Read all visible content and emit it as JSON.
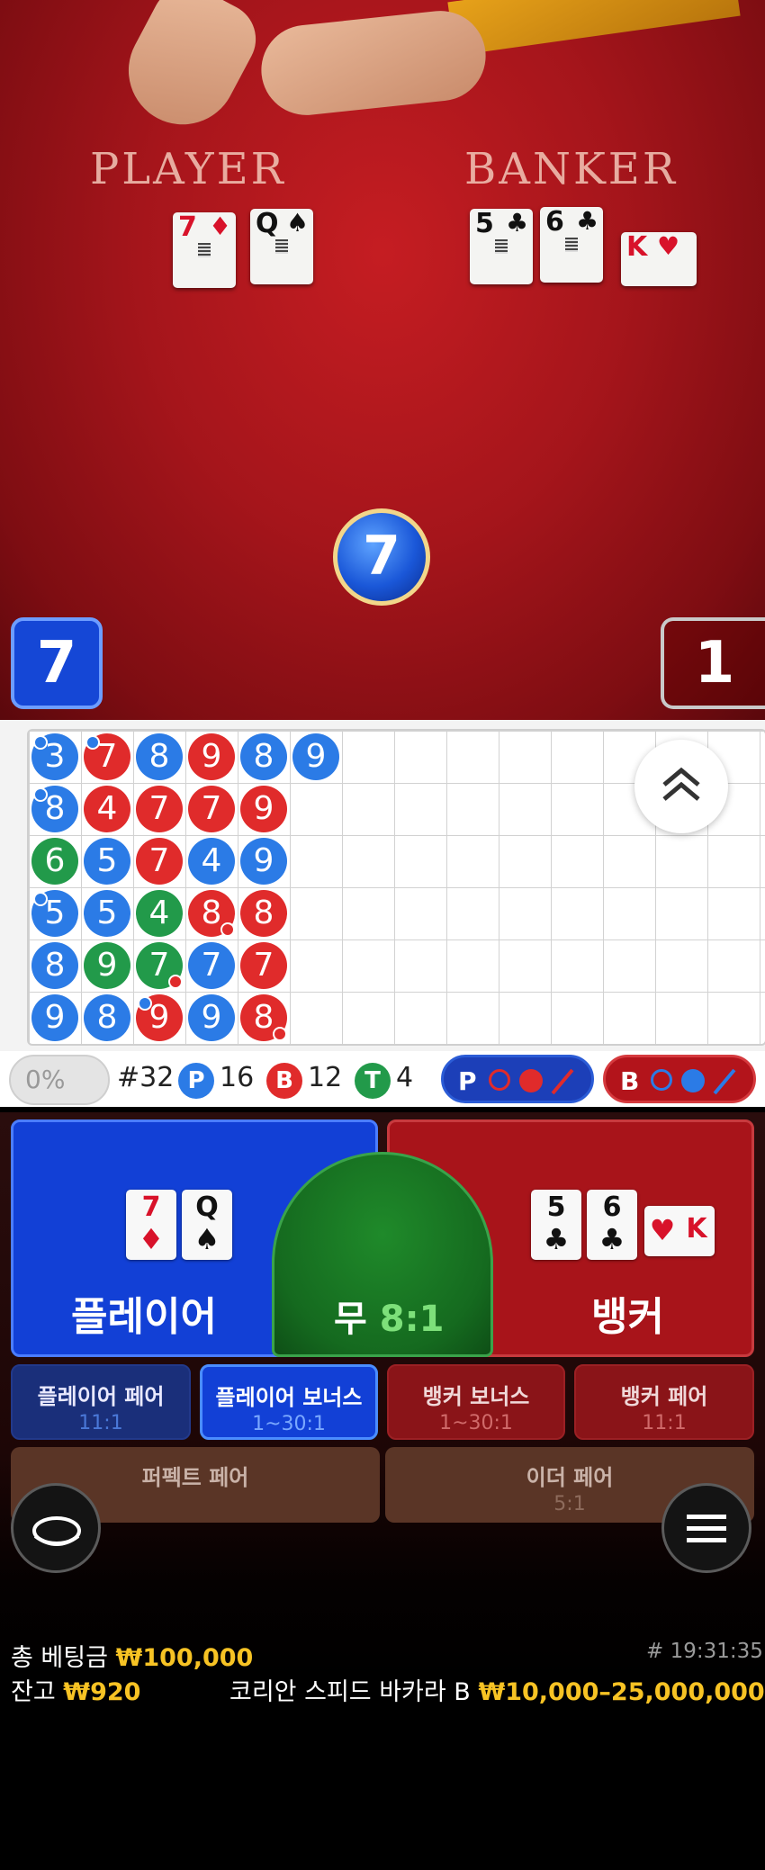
{
  "table": {
    "player_label": "PLAYER",
    "banker_label": "BANKER",
    "ball_value": "7",
    "player_score": "7",
    "banker_score": "1",
    "player_cards": [
      {
        "rank": "7",
        "suit": "♦",
        "color": "red"
      },
      {
        "rank": "Q",
        "suit": "♠",
        "color": "black"
      }
    ],
    "banker_cards": [
      {
        "rank": "5",
        "suit": "♣",
        "color": "black"
      },
      {
        "rank": "6",
        "suit": "♣",
        "color": "black"
      },
      {
        "rank": "K",
        "suit": "♥",
        "color": "red"
      }
    ]
  },
  "roadmap": {
    "beads": [
      [
        {
          "v": "3",
          "t": "P",
          "pp": true
        },
        {
          "v": "8",
          "t": "P",
          "pp": true
        },
        {
          "v": "6",
          "t": "T"
        },
        {
          "v": "5",
          "t": "P",
          "pp": true
        },
        {
          "v": "8",
          "t": "P"
        },
        {
          "v": "9",
          "t": "P"
        }
      ],
      [
        {
          "v": "7",
          "t": "B",
          "pp": true
        },
        {
          "v": "4",
          "t": "B"
        },
        {
          "v": "5",
          "t": "P"
        },
        {
          "v": "5",
          "t": "P"
        },
        {
          "v": "9",
          "t": "T"
        },
        {
          "v": "8",
          "t": "P"
        }
      ],
      [
        {
          "v": "8",
          "t": "P"
        },
        {
          "v": "7",
          "t": "B"
        },
        {
          "v": "7",
          "t": "B"
        },
        {
          "v": "4",
          "t": "T"
        },
        {
          "v": "7",
          "t": "T",
          "bp": true
        },
        {
          "v": "9",
          "t": "B",
          "pp": true
        }
      ],
      [
        {
          "v": "9",
          "t": "B"
        },
        {
          "v": "7",
          "t": "B"
        },
        {
          "v": "4",
          "t": "P"
        },
        {
          "v": "8",
          "t": "B",
          "bp": true
        },
        {
          "v": "7",
          "t": "P"
        },
        {
          "v": "9",
          "t": "P"
        }
      ],
      [
        {
          "v": "8",
          "t": "P"
        },
        {
          "v": "9",
          "t": "B"
        },
        {
          "v": "9",
          "t": "P"
        },
        {
          "v": "8",
          "t": "B"
        },
        {
          "v": "7",
          "t": "B"
        },
        {
          "v": "8",
          "t": "B",
          "bp": true
        }
      ],
      [
        {
          "v": "9",
          "t": "P"
        }
      ]
    ],
    "collapse_icon": "chevron-double-up-icon"
  },
  "stats": {
    "percent": "0%",
    "round": "#32",
    "p_letter": "P",
    "p_count": "16",
    "b_letter": "B",
    "b_count": "12",
    "t_letter": "T",
    "t_count": "4",
    "p_predict_label": "P",
    "b_predict_label": "B"
  },
  "bets": {
    "player_label": "플레이어",
    "tie_label": "무",
    "tie_odds": "8:1",
    "banker_label": "뱅커",
    "side": [
      {
        "name": "플레이어 페어",
        "odds": "11:1"
      },
      {
        "name": "플레이어 보너스",
        "odds": "1~30:1"
      },
      {
        "name": "뱅커 보너스",
        "odds": "1~30:1"
      },
      {
        "name": "뱅커 페어",
        "odds": "11:1"
      }
    ],
    "perfect_pair": "퍼펙트 페어",
    "either_pair": "이더 페어",
    "either_pair_odds": "5:1"
  },
  "footer": {
    "total_bet_label": "총 베팅금",
    "total_bet_value": "₩100,000",
    "balance_label": "잔고",
    "balance_value": "₩920",
    "time": "# 19:31:35",
    "table_name": "코리안 스피드 바카라 B",
    "limits": "₩10,000–25,000,000"
  },
  "colors": {
    "player": "#1240d6",
    "banker": "#a8141a",
    "tie": "#156a1f",
    "gold": "#f7c324"
  }
}
